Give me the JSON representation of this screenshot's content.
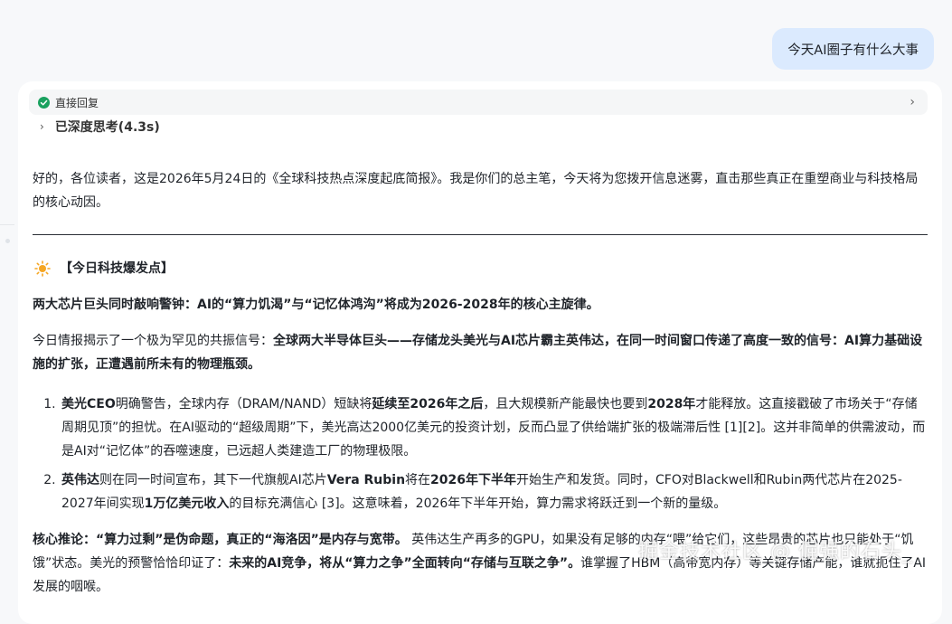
{
  "user_message": "今天AI圈子有什么大事",
  "reply_mode": {
    "label": "直接回复"
  },
  "thinking": {
    "label": "已深度思考(4.3s)"
  },
  "intro": "好的，各位读者，这是2026年5月24日的《全球科技热点深度起底简报》。我是你们的总主笔，今天将为您拨开信息迷雾，直击那些真正在重塑商业与科技格局的核心动因。",
  "section": {
    "title": "【今日科技爆发点】",
    "lead": "两大芯片巨头同时敲响警钟：AI的“算力饥渴”与“记忆体鸿沟”将成为2026-2028年的核心主旋律。",
    "para_prefix": "今日情报揭示了一个极为罕见的共振信号：",
    "para_bold": "全球两大半导体巨头——存储龙头美光与AI芯片霸主英伟达，在同一时间窗口传递了高度一致的信号：AI算力基础设施的扩张，正遭遇前所未有的物理瓶颈。",
    "item1": {
      "b1": "美光CEO",
      "t1": "明确警告，全球内存（DRAM/NAND）短缺将",
      "b2": "延续至2026年之后",
      "t2": "，且大规模新产能最快也要到",
      "b3": "2028年",
      "t3": "才能释放。这直接戳破了市场关于“存储周期见顶”的担忧。在AI驱动的“超级周期”下，美光高达2000亿美元的投资计划，反而凸显了供给端扩张的极端滞后性 [1][2]。这并非简单的供需波动，而是AI对“记忆体”的吞噬速度，已远超人类建造工厂的物理极限。"
    },
    "item2": {
      "b1": "英伟达",
      "t1": "则在同一时间宣布，其下一代旗舰AI芯片",
      "b2": "Vera Rubin",
      "t2": "将在",
      "b3": "2026年下半年",
      "t3": "开始生产和发货。同时，CFO对Blackwell和Rubin两代芯片在2025-2027年间实现",
      "b4": "1万亿美元收入",
      "t4": "的目标充满信心 [3]。这意味着，2026年下半年开始，算力需求将跃迁到一个新的量级。"
    },
    "core": {
      "b1": "核心推论：“算力过剩”是伪命题，真正的“海洛因”是内存与宽带。",
      "t1": " 英伟达生产再多的GPU，如果没有足够的内存“喂”给它们，这些昂贵的芯片也只能处于“饥饿”状态。美光的预警恰恰印证了：",
      "b2": "未来的AI竞争，将从“算力之争”全面转向“存储与互联之争”。",
      "t2": "谁掌握了HBM（高带宽内存）等关键存储产能，谁就扼住了AI发展的咽喉。"
    }
  },
  "watermark": "掘金技术社区 @ 倔强的石头_",
  "colors": {
    "user_bubble": "#dbeafe",
    "check": "#1aa15f",
    "sun": "#f5a623"
  }
}
